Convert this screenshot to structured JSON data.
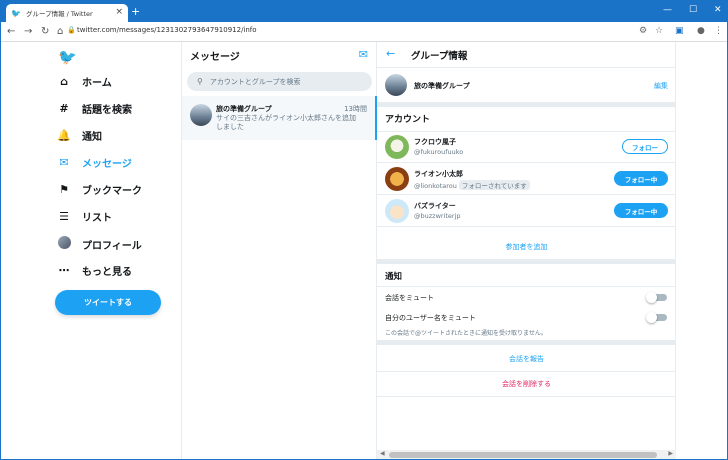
{
  "browser": {
    "tab_title": "グループ情報 / Twitter",
    "url": "twitter.com/messages/1231302793647910912/info",
    "tab_close": "×",
    "new_tab": "+"
  },
  "icons": {
    "twitter": "twitter-bird-icon",
    "home": "home-icon",
    "explore": "hashtag-icon",
    "notifications": "bell-icon",
    "messages": "envelope-icon",
    "bookmarks": "bookmark-icon",
    "lists": "list-icon",
    "more": "more-circle-icon",
    "compose": "compose-message-icon",
    "search": "search-icon",
    "back": "back-arrow-icon"
  },
  "colors": {
    "accent": "#1da1f2",
    "danger": "#e0245e",
    "titlebar": "#1a73c7"
  },
  "sidebar": {
    "items": [
      {
        "label": "ホーム"
      },
      {
        "label": "話題を検索"
      },
      {
        "label": "通知"
      },
      {
        "label": "メッセージ",
        "active": true
      },
      {
        "label": "ブックマーク"
      },
      {
        "label": "リスト"
      },
      {
        "label": "プロフィール"
      },
      {
        "label": "もっと見る"
      }
    ],
    "tweet_button": "ツイートする"
  },
  "messages": {
    "title": "メッセージ",
    "search_placeholder": "アカウントとグループを検索",
    "conversations": [
      {
        "name": "旅の準備グループ",
        "time": "13時間",
        "preview": "サイの三吉さんがライオン小太郎さんを追加しました"
      }
    ]
  },
  "info": {
    "title": "グループ情報",
    "group_name": "旅の準備グループ",
    "edit": "編集",
    "accounts_heading": "アカウント",
    "users": [
      {
        "name": "フクロウ風子",
        "handle": "@fukuroufuuko",
        "follows_you": "",
        "button": "フォロー"
      },
      {
        "name": "ライオン小太郎",
        "handle": "@lionkotarou",
        "follows_you": "フォローされています",
        "button": "フォロー中"
      },
      {
        "name": "バズライター",
        "handle": "@buzzwriterjp",
        "follows_you": "",
        "button": "フォロー中"
      }
    ],
    "add_participant": "参加者を追加",
    "notifications_heading": "通知",
    "mute_conversation": "会話をミュート",
    "mute_mentions": "自分のユーザー名をミュート",
    "mute_note": "この会話で@ツイートされたときに通知を受け取りません。",
    "report": "会話を報告",
    "delete": "会話を削除する"
  }
}
